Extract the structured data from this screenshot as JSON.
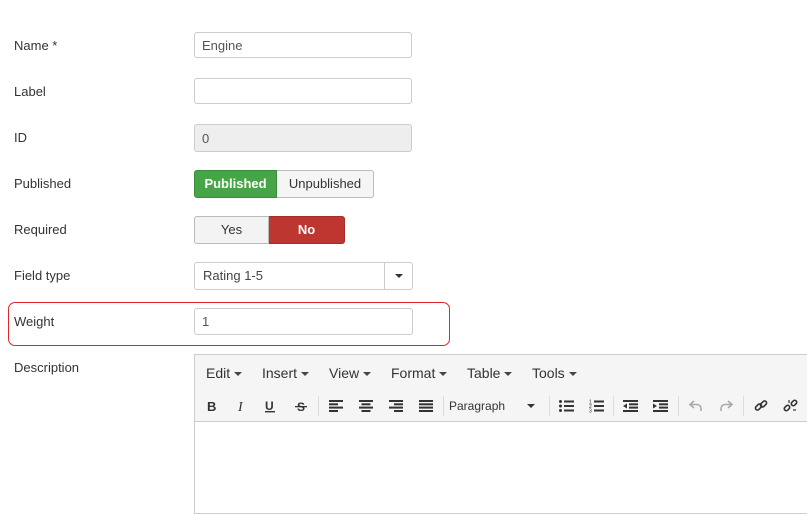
{
  "form": {
    "name": {
      "label": "Name *",
      "value": "Engine"
    },
    "label_field": {
      "label": "Label",
      "value": ""
    },
    "id_field": {
      "label": "ID",
      "value": "0"
    },
    "published": {
      "label": "Published",
      "option_on": "Published",
      "option_off": "Unpublished",
      "selected": "Published"
    },
    "required": {
      "label": "Required",
      "option_yes": "Yes",
      "option_no": "No",
      "selected": "No"
    },
    "field_type": {
      "label": "Field type",
      "value": "Rating 1-5"
    },
    "weight": {
      "label": "Weight",
      "value": "1"
    },
    "description": {
      "label": "Description"
    }
  },
  "editor": {
    "menus": [
      "Edit",
      "Insert",
      "View",
      "Format",
      "Table",
      "Tools"
    ],
    "format_select": "Paragraph"
  },
  "colors": {
    "published_green": "#46a546",
    "no_red": "#bd362f",
    "highlight_red": "#e0262b"
  }
}
